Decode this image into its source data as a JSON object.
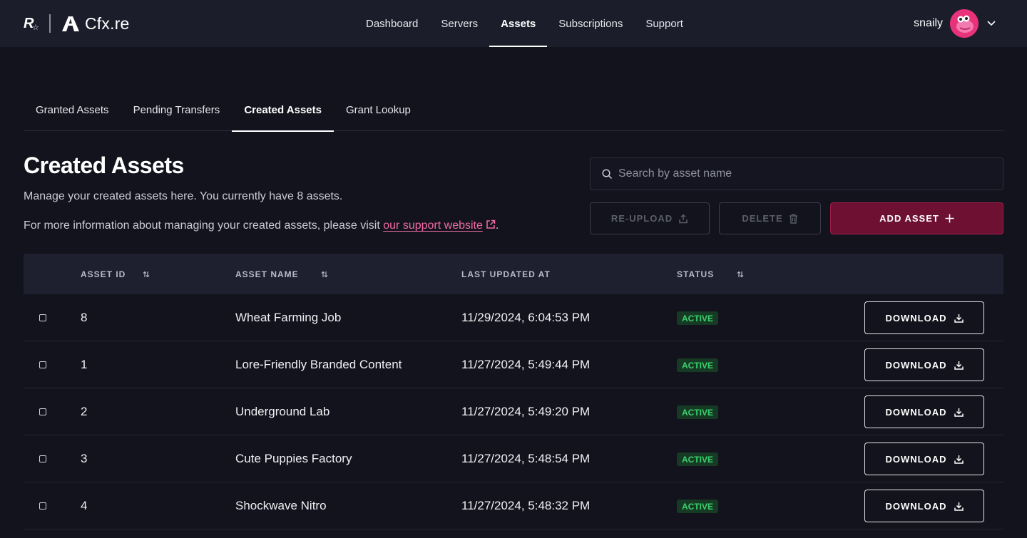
{
  "brand": {
    "name": "Cfx.re"
  },
  "nav": {
    "items": [
      {
        "label": "Dashboard",
        "active": false
      },
      {
        "label": "Servers",
        "active": false
      },
      {
        "label": "Assets",
        "active": true
      },
      {
        "label": "Subscriptions",
        "active": false
      },
      {
        "label": "Support",
        "active": false
      }
    ]
  },
  "user": {
    "name": "snaily",
    "avatar_color": "#e8327a"
  },
  "subtabs": [
    {
      "label": "Granted Assets",
      "active": false
    },
    {
      "label": "Pending Transfers",
      "active": false
    },
    {
      "label": "Created Assets",
      "active": true
    },
    {
      "label": "Grant Lookup",
      "active": false
    }
  ],
  "page": {
    "title": "Created Assets",
    "description": "Manage your created assets here. You currently have 8 assets.",
    "more_info_prefix": "For more information about managing your created assets, please visit ",
    "support_link": "our support website",
    "more_info_suffix": "."
  },
  "search": {
    "placeholder": "Search by asset name",
    "value": ""
  },
  "actions": {
    "reupload": "RE-UPLOAD",
    "delete": "DELETE",
    "add": "ADD ASSET"
  },
  "table": {
    "headers": {
      "asset_id": "ASSET ID",
      "asset_name": "ASSET NAME",
      "last_updated": "LAST UPDATED AT",
      "status": "STATUS"
    },
    "download_label": "DOWNLOAD",
    "rows": [
      {
        "id": "8",
        "name": "Wheat Farming Job",
        "updated": "11/29/2024, 6:04:53 PM",
        "status": "ACTIVE"
      },
      {
        "id": "1",
        "name": "Lore-Friendly Branded Content",
        "updated": "11/27/2024, 5:49:44 PM",
        "status": "ACTIVE"
      },
      {
        "id": "2",
        "name": "Underground Lab",
        "updated": "11/27/2024, 5:49:20 PM",
        "status": "ACTIVE"
      },
      {
        "id": "3",
        "name": "Cute Puppies Factory",
        "updated": "11/27/2024, 5:48:54 PM",
        "status": "ACTIVE"
      },
      {
        "id": "4",
        "name": "Shockwave Nitro",
        "updated": "11/27/2024, 5:48:32 PM",
        "status": "ACTIVE"
      }
    ]
  },
  "colors": {
    "background": "#12131c",
    "topbar": "#1b1d2a",
    "accent": "#6d1032",
    "link": "#f06ba6",
    "status_active": "#3bd16f"
  }
}
